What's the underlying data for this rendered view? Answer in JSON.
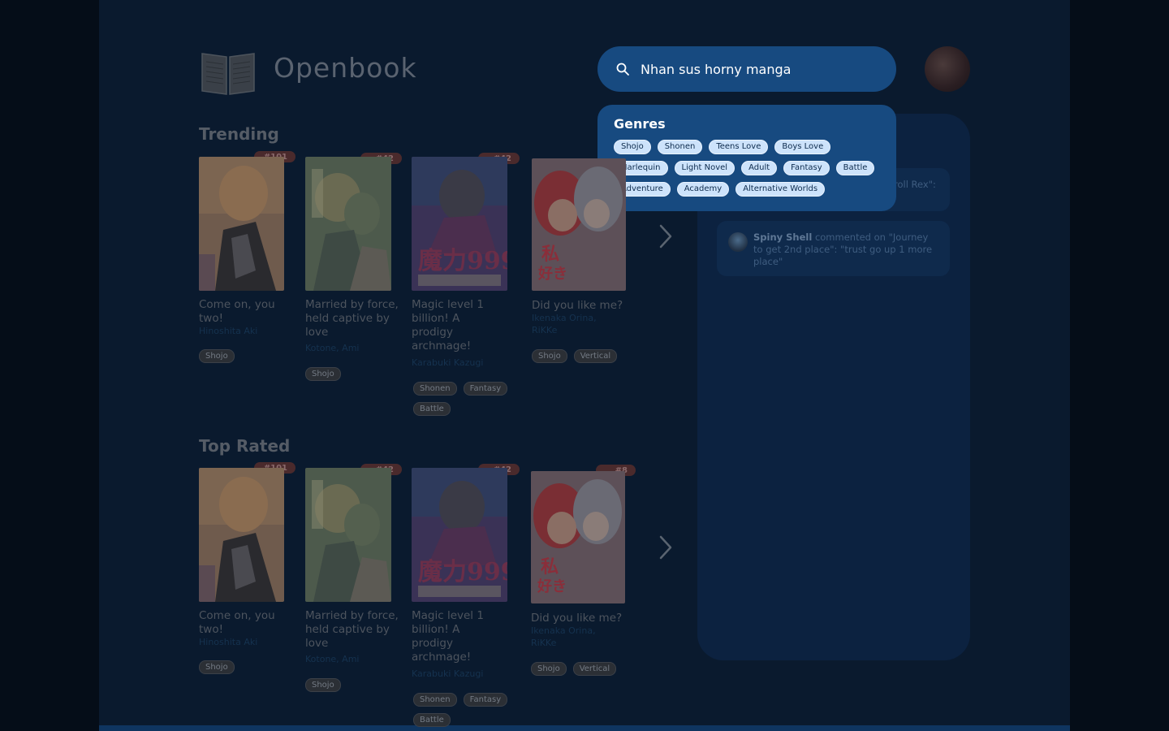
{
  "app": {
    "name": "Openbook"
  },
  "search": {
    "value": "Nhan sus horny manga"
  },
  "genres": {
    "heading": "Genres",
    "rows": [
      [
        "Shojo",
        "Shonen",
        "Teens Love",
        "Boys Love"
      ],
      [
        "Harlequin",
        "Light Novel",
        "Adult",
        "Fantasy",
        "Battle"
      ],
      [
        "Adventure",
        "Academy",
        "Alternative Worlds"
      ]
    ]
  },
  "activity": {
    "items": [
      {
        "partial": "roll Rex\":"
      },
      {
        "user": "Spiny Shell",
        "text": " commented on \"Journey to get 2nd place\": \"trust go up 1 more place\""
      }
    ]
  },
  "sections": [
    {
      "title": "Trending",
      "books": [
        {
          "rank": "#101",
          "title": "Come on, you two!",
          "authors": "Hinoshita Aki",
          "tags": [
            "Shojo"
          ]
        },
        {
          "rank": "#42",
          "title": "Married by force, held captive by love",
          "authors": "Kotone, Ami",
          "tags": [
            "Shojo"
          ]
        },
        {
          "rank": "#42",
          "title": "Magic level 1 billion! A prodigy archmage!",
          "authors": "Karabuki Kazugi",
          "tags": [
            "Shonen",
            "Fantasy",
            "Battle"
          ]
        },
        {
          "rank": "",
          "title": "Did you like me?",
          "authors": "Ikenaka Orina, RiKKe",
          "tags": [
            "Shojo",
            "Vertical"
          ]
        }
      ]
    },
    {
      "title": "Top Rated",
      "books": [
        {
          "rank": "#101",
          "title": "Come on, you two!",
          "authors": "Hinoshita Aki",
          "tags": [
            "Shojo"
          ]
        },
        {
          "rank": "#42",
          "title": "Married by force, held captive by love",
          "authors": "Kotone, Ami",
          "tags": [
            "Shojo"
          ]
        },
        {
          "rank": "#42",
          "title": "Magic level 1 billion! A prodigy archmage!",
          "authors": "Karabuki Kazugi",
          "tags": [
            "Shonen",
            "Fantasy",
            "Battle"
          ]
        },
        {
          "rank": "#8",
          "title": "Did you like me?",
          "authors": "Ikenaka Orina, RiKKe",
          "tags": [
            "Shojo",
            "Vertical"
          ]
        }
      ]
    }
  ]
}
